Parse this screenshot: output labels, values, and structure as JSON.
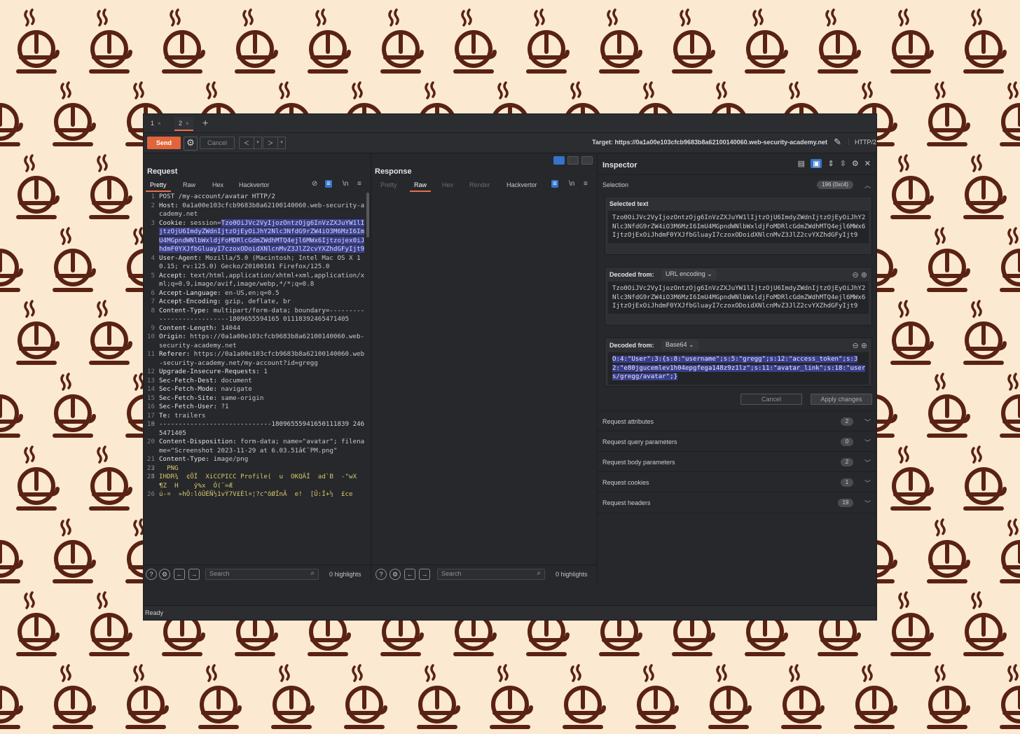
{
  "tabs": [
    {
      "label": "1",
      "close": "×"
    },
    {
      "label": "2",
      "close": "×"
    }
  ],
  "tab_add": "+",
  "toolbar": {
    "send": "Send",
    "cancel": "Cancel",
    "back": "<",
    "forward": ">",
    "target_label": "Target: https://0a1a00e103cfcb9683b8a62100140060.web-security-academy.net",
    "http_version": "HTTP/2"
  },
  "request": {
    "title": "Request",
    "tabs": [
      "Pretty",
      "Raw",
      "Hex",
      "Hackvertor"
    ],
    "newline_toggle": "\\n",
    "lines": [
      {
        "n": "1",
        "text": "POST /my-account/avatar HTTP/2"
      },
      {
        "n": "2",
        "k": "Host:",
        "v": " 0a1a00e103cfcb9683b8a62100140060.web-security-academy.net"
      },
      {
        "n": "3",
        "k": "Cookie:",
        "v": " session=",
        "hl": "Tzo0OiJVc2VyIjozOntzOjg6InVzZXJuYW1lIjtzOjU6ImdyZWdnIjtzOjEyOiJhY2Nlc3NfdG9rZW4iO3M6MzI6ImU4MGpndWNlbWxldjFoMDRlcGdmZWdhMTQ4ejl6MWx6Ijtzojex0iJhdmF0YXJfbGluayI7czoxODoidXNlcnMvZ3JlZ2cvYXZhdGFyIjt9"
      },
      {
        "n": "4",
        "k": "User-Agent:",
        "v": " Mozilla/5.0 (Macintosh; Intel Mac OS X 10.15; rv:125.0) Gecko/20100101 Firefox/125.0"
      },
      {
        "n": "5",
        "k": "Accept:",
        "v": " text/html,application/xhtml+xml,application/xml;q=0.9,image/avif,image/webp,*/*;q=0.8"
      },
      {
        "n": "6",
        "k": "Accept-Language:",
        "v": " en-US,en;q=0.5"
      },
      {
        "n": "7",
        "k": "Accept-Encoding:",
        "v": " gzip, deflate, br"
      },
      {
        "n": "8",
        "k": "Content-Type:",
        "v": " multipart/form-data; boundary=---------------------------1809655594165 01118392465471405"
      },
      {
        "n": "9",
        "k": "Content-Length:",
        "v": " 14044"
      },
      {
        "n": "10",
        "k": "Origin:",
        "v": " https://0a1a00e103cfcb9683b8a62100140060.web-security-academy.net"
      },
      {
        "n": "11",
        "k": "Referer:",
        "v": " https://0a1a00e103cfcb9683b8a62100140060.web-security-academy.net/my-account?id=gregg"
      },
      {
        "n": "12",
        "k": "Upgrade-Insecure-Requests:",
        "v": " 1"
      },
      {
        "n": "13",
        "k": "Sec-Fetch-Dest:",
        "v": " document"
      },
      {
        "n": "14",
        "k": "Sec-Fetch-Mode:",
        "v": " navigate"
      },
      {
        "n": "15",
        "k": "Sec-Fetch-Site:",
        "v": " same-origin"
      },
      {
        "n": "16",
        "k": "Sec-Fetch-User:",
        "v": " ?1"
      },
      {
        "n": "17",
        "k": "Te:",
        "v": " trailers"
      },
      {
        "n": "18",
        "text": ""
      },
      {
        "n": "19",
        "text": "-----------------------------18096555941650111839 2465471405"
      },
      {
        "n": "20",
        "k": "Content-Disposition:",
        "v": " form-data; name=\"avatar\"; filename=\"Screenshot 2023-11-29 at 6.03.51â€¯PM.png\""
      },
      {
        "n": "21",
        "k": "Content-Type:",
        "v": " image/png"
      },
      {
        "n": "22",
        "text": ""
      },
      {
        "n": "23",
        "y": "  PNG"
      },
      {
        "n": "24",
        "text": ""
      },
      {
        "n": "25",
        "y": "IHDR¾  ¢ÕÏ  XiCCPICC Profile(  u  OKQÂÎ  ad`B  -\"wX  ¶Z  H    ý%x  Ó(¨=Æ"
      },
      {
        "n": "26",
        "y": "ú-¤  »hÕ:lôÛÉÑ½1vÝ7V£Èl¤¦?c^ôØÎnÃ  e!  [Û:Î+½  £ce"
      }
    ],
    "search_placeholder": "Search",
    "highlights": "0 highlights"
  },
  "response": {
    "title": "Response",
    "tabs": [
      "Pretty",
      "Raw",
      "Hex",
      "Render",
      "Hackvertor"
    ],
    "newline_toggle": "\\n",
    "search_placeholder": "Search",
    "highlights": "0 highlights"
  },
  "inspector": {
    "title": "Inspector",
    "selection_label": "Selection",
    "selection_count": "196 (0xc4)",
    "selected_text_title": "Selected text",
    "selected_text": "Tzo0OiJVc2VyIjozOntzOjg6InVzZXJuYW1lIjtzOjU6ImdyZWdnIjtzOjEyOiJhY2Nlc3NfdG9rZW4iO3M6MzI6ImU4MGpndWNlbWxldjFoMDRlcGdmZWdhMTQ4ejl6MWx6IjtzOjExOiJhdmF0YXJfbGluayI7czoxODoidXNlcnMvZ3JlZ2cvYXZhdGFyIjt9",
    "decoded_from_label": "Decoded from:",
    "decoded1_type": "URL encoding",
    "decoded1_text": "Tzo0OiJVc2VyIjozOntzOjg6InVzZXJuYW1lIjtzOjU6ImdyZWdnIjtzOjEyOiJhY2Nlc3NfdG9rZW4iO3M6MzI6ImU4MGpndWNlbWxldjFoMDRlcGdmZWdhMTQ4ejl6MWx6IjtzOjExOiJhdmF0YXJfbGluayI7czoxODoidXNlcnMvZ3JlZ2cvYXZhdGFyIjt9",
    "decoded2_type": "Base64",
    "decoded2_text": "O:4:\"User\":3:{s:8:\"username\";s:5:\"gregg\";s:12:\"access_token\";s:32:\"e80jgucemlev1h04epgfega148z9z1lz\";s:11:\"avatar_link\";s:18:\"users/gregg/avatar\";}",
    "cancel": "Cancel",
    "apply": "Apply changes",
    "sections": [
      {
        "label": "Request attributes",
        "count": "2"
      },
      {
        "label": "Request query parameters",
        "count": "0"
      },
      {
        "label": "Request body parameters",
        "count": "2"
      },
      {
        "label": "Request cookies",
        "count": "1"
      },
      {
        "label": "Request headers",
        "count": "19"
      }
    ]
  },
  "status": "Ready",
  "colors": {
    "accent": "#e1643a",
    "background": "#fbe9d2",
    "pattern": "#5a2212",
    "window": "#26282b",
    "highlight": "#3a3f8a"
  },
  "icons": {
    "background": "coffee-cup-icon"
  }
}
